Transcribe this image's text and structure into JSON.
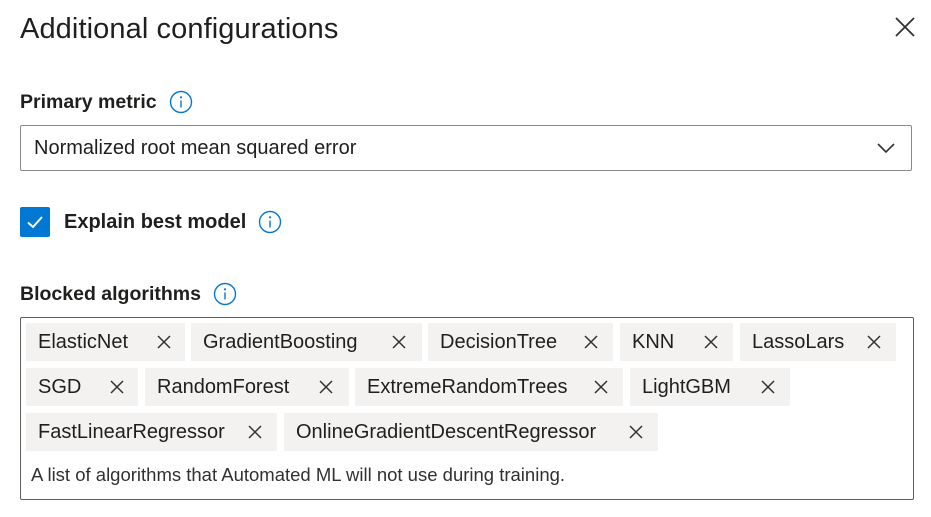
{
  "dialog": {
    "title": "Additional configurations",
    "close_icon": "close-icon"
  },
  "primary_metric": {
    "label": "Primary metric",
    "info_icon": "info-icon",
    "value": "Normalized root mean squared error",
    "chevron_icon": "chevron-down-icon"
  },
  "explain": {
    "label": "Explain best model",
    "checked": true,
    "info_icon": "info-icon"
  },
  "blocked": {
    "label": "Blocked algorithms",
    "info_icon": "info-icon",
    "tags": [
      {
        "label": "ElasticNet"
      },
      {
        "label": "GradientBoosting"
      },
      {
        "label": "DecisionTree"
      },
      {
        "label": "KNN"
      },
      {
        "label": "LassoLars"
      },
      {
        "label": "SGD"
      },
      {
        "label": "RandomForest"
      },
      {
        "label": "ExtremeRandomTrees"
      },
      {
        "label": "LightGBM"
      },
      {
        "label": "FastLinearRegressor"
      },
      {
        "label": "OnlineGradientDescentRegressor"
      }
    ],
    "helper_text": "A list of algorithms that Automated ML will not use during training."
  },
  "colors": {
    "accent": "#0078d4",
    "tag_background": "#f3f2f1",
    "border": "#8a8886"
  }
}
